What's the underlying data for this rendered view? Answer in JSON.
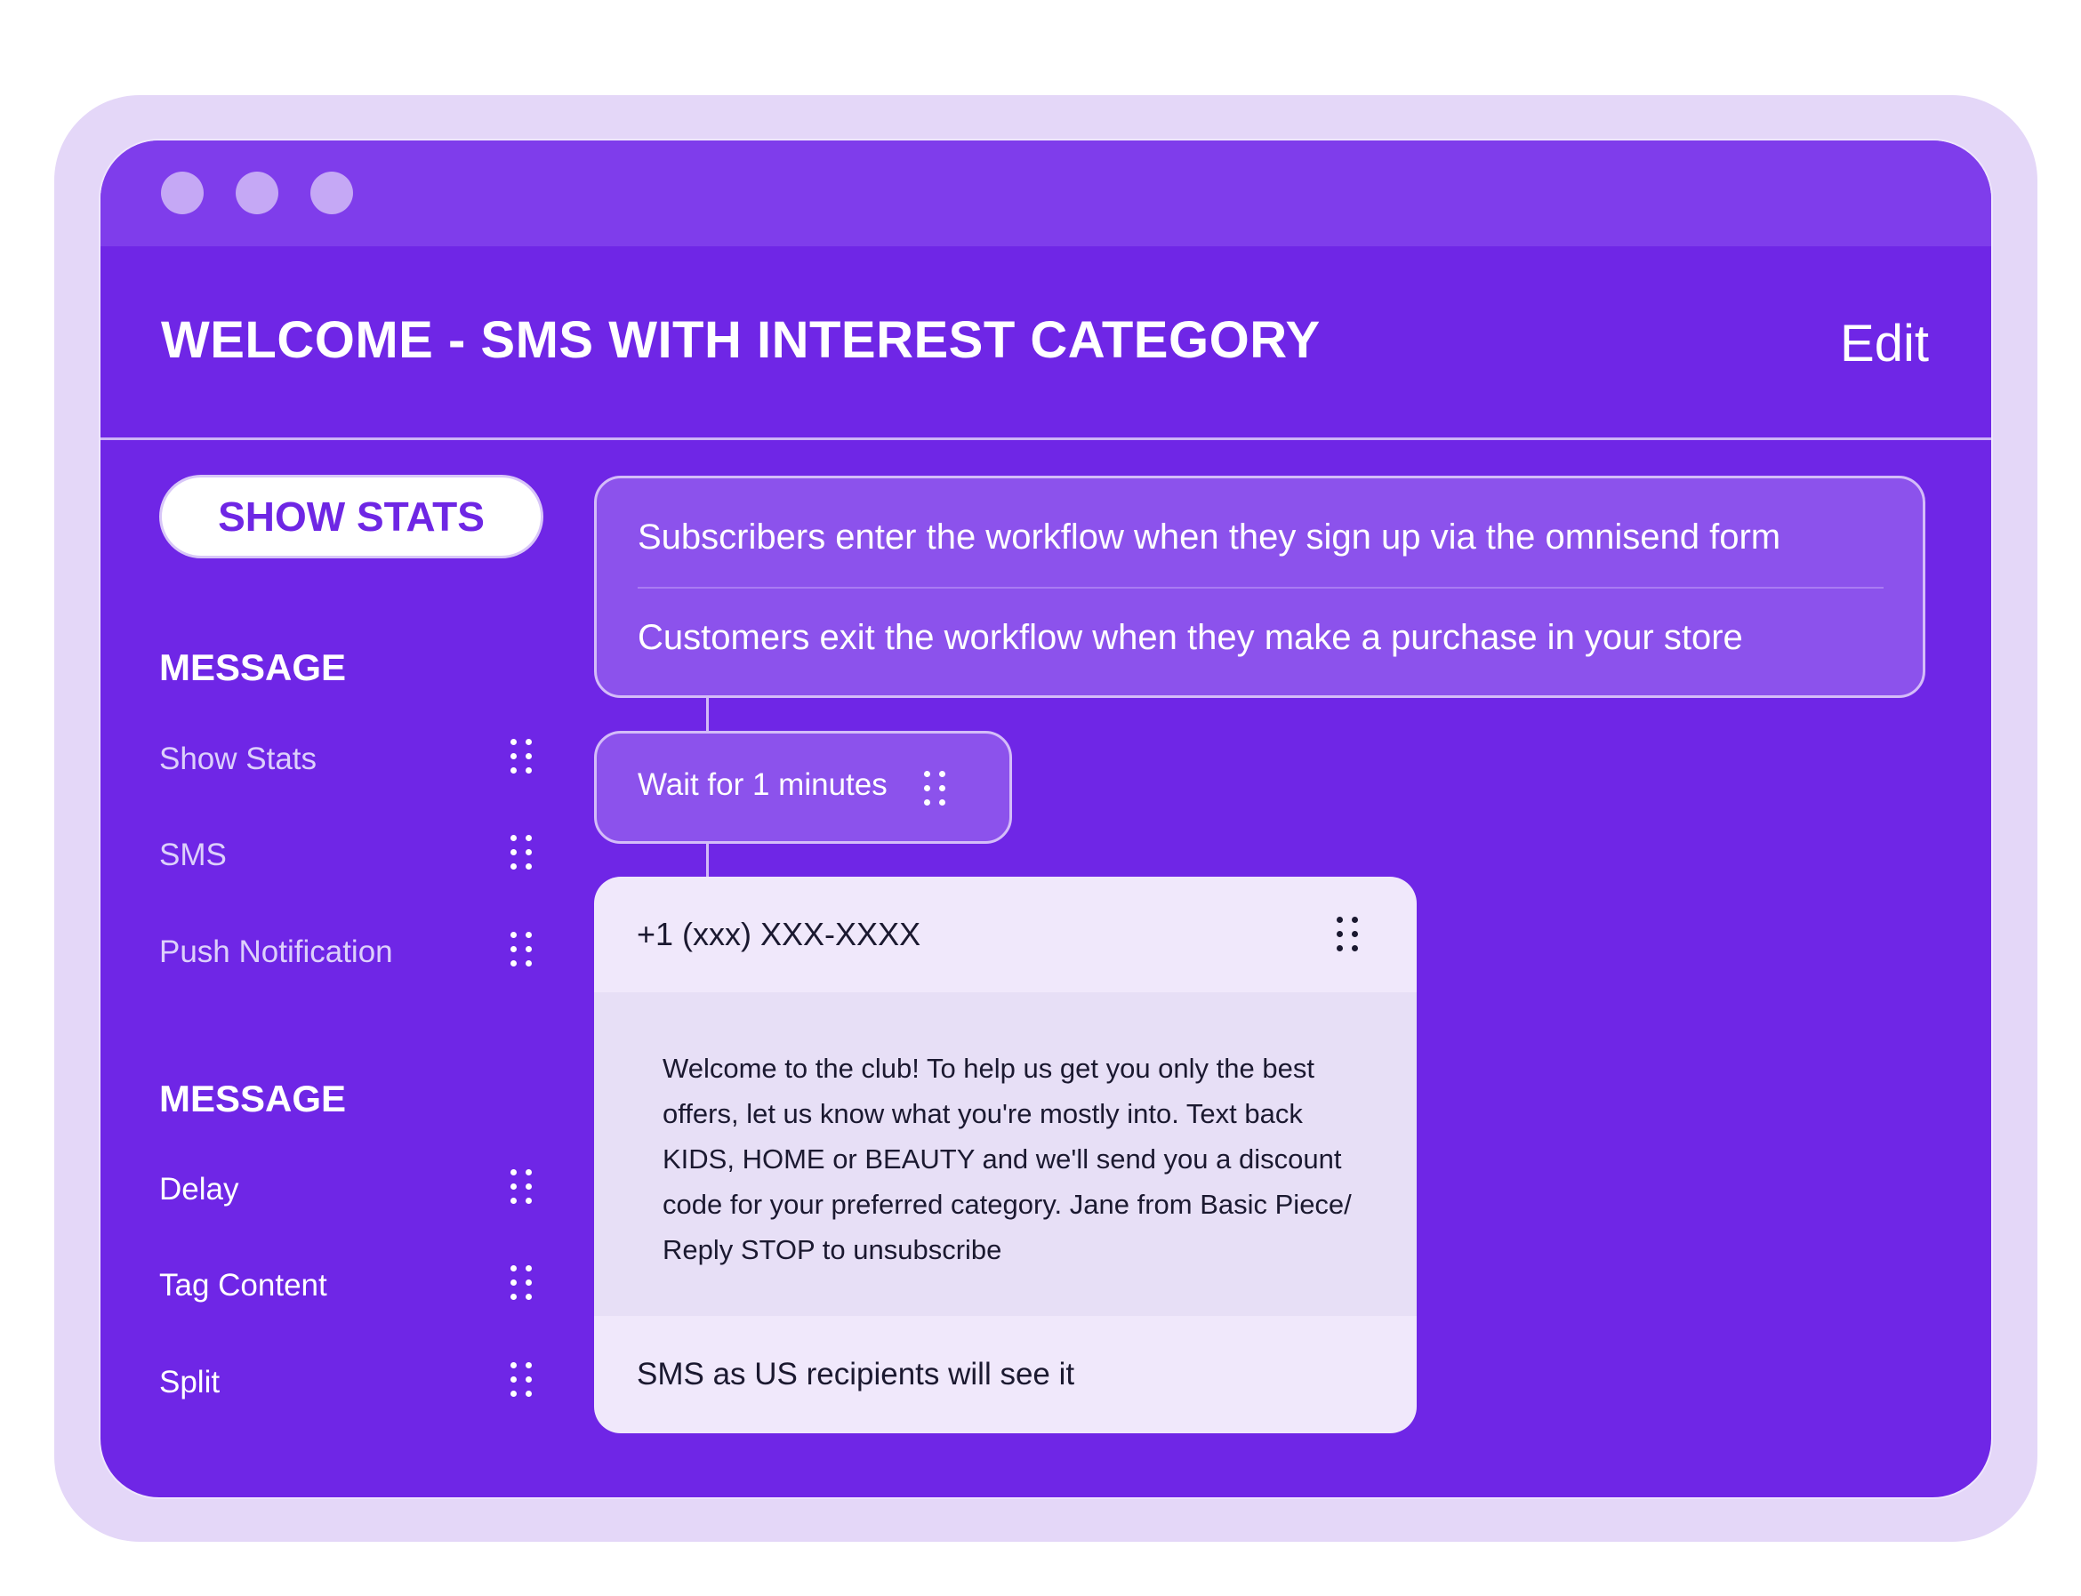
{
  "window": {
    "title": "WELCOME - SMS WITH INTEREST CATEGORY",
    "edit_label": "Edit"
  },
  "sidebar": {
    "show_stats_button": "SHOW STATS",
    "sections": [
      {
        "title": "MESSAGE",
        "items": [
          {
            "label": "Show Stats"
          },
          {
            "label": "SMS"
          },
          {
            "label": "Push Notification"
          }
        ]
      },
      {
        "title": "MESSAGE",
        "items": [
          {
            "label": "Delay"
          },
          {
            "label": "Tag Content"
          },
          {
            "label": "Split"
          }
        ]
      }
    ]
  },
  "workflow": {
    "trigger": {
      "enter": "Subscribers enter the workflow when they sign up via the omnisend form",
      "exit": "Customers exit the workflow when they make a purchase in your store"
    },
    "wait": {
      "label": "Wait for 1 minutes"
    },
    "sms": {
      "phone": "+1 (xxx) XXX-XXXX",
      "body": "Welcome to the club! To help us get you only the best offers, let us know what you're mostly into. Text back KIDS, HOME or BEAUTY and we'll send you a discount code for your preferred category. Jane from Basic Piece/ Reply STOP to unsubscribe",
      "footer": "SMS as US recipients will see it"
    }
  },
  "colors": {
    "window_bg": "#6f26e6",
    "titlebar_bg": "#7f3deb",
    "frame_bg": "#e4d7f8",
    "node_bg": "#8c52ec",
    "card_bg": "#f0e8fb",
    "accent": "#6e26e4"
  },
  "icons": {
    "window_controls": [
      "window-dot-icon",
      "window-dot-icon",
      "window-dot-icon"
    ],
    "drag": "drag-handle-icon"
  }
}
